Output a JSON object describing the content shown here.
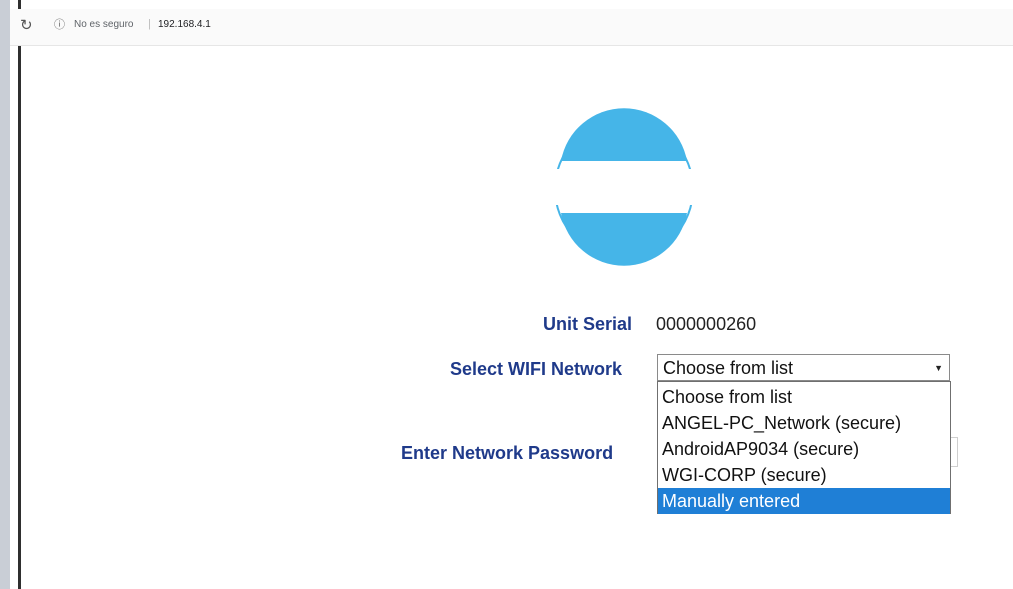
{
  "browser": {
    "security_text": "No es seguro",
    "separator": "|",
    "url": "192.168.4.1"
  },
  "form": {
    "unit_serial_label": "Unit Serial",
    "unit_serial_value": "0000000260",
    "wifi_label": "Select WIFI Network",
    "wifi_selected": "Choose from list",
    "password_label": "Enter Network Password"
  },
  "dropdown": {
    "options": [
      "Choose from list",
      "ANGEL-PC_Network (secure)",
      "AndroidAP9034 (secure)",
      "WGI-CORP (secure)",
      "Manually entered"
    ],
    "highlighted_index": 4
  },
  "colors": {
    "logo_blue": "#45b5e8",
    "label_blue": "#1f3a8a",
    "highlight": "#1f7fd6"
  },
  "icons": {
    "reload": "reload-icon",
    "info": "info-icon",
    "dropdown_arrow": "dropdown-arrow-icon"
  }
}
